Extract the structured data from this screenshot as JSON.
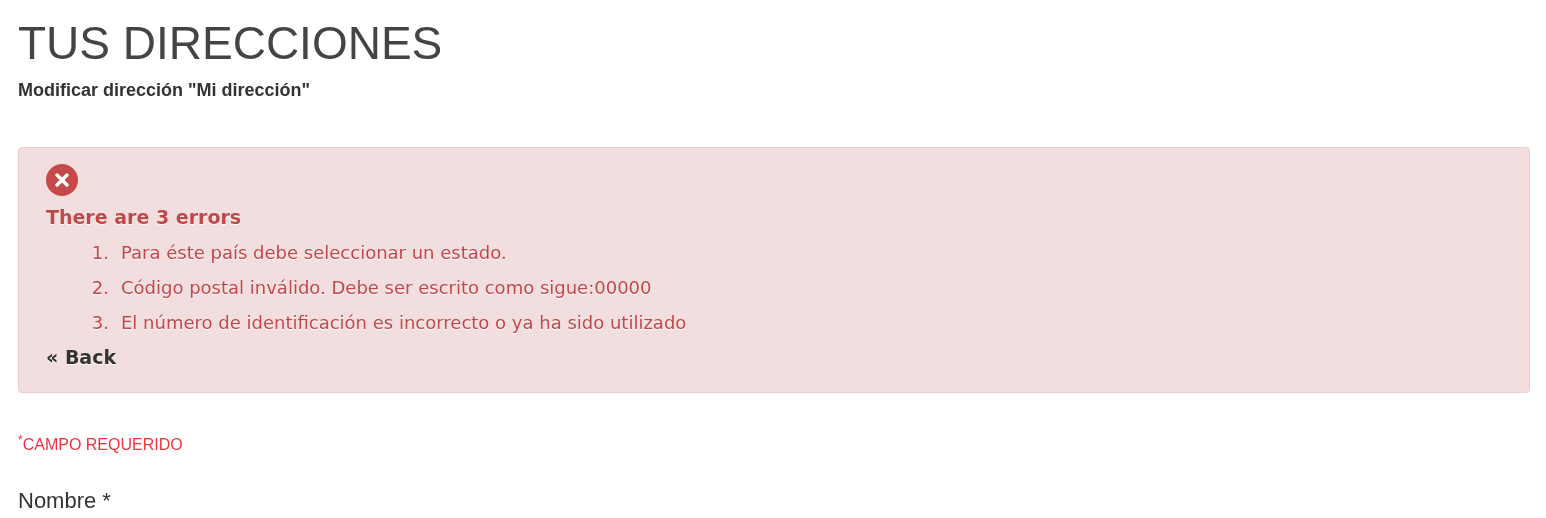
{
  "page_title": "TUS DIRECCIONES",
  "subtitle": "Modificar dirección \"Mi dirección\"",
  "alert": {
    "heading": "There are 3 errors",
    "errors": [
      {
        "number": "1.",
        "text": "Para éste país debe seleccionar un estado."
      },
      {
        "number": "2.",
        "text": "Código postal inválido. Debe ser escrito como sigue:00000"
      },
      {
        "number": "3.",
        "text": "El número de identificación es incorrecto o ya ha sido utilizado"
      }
    ],
    "back_link": "« Back"
  },
  "required_note": "$^{*}$CAMPO REQUERIDO",
  "field_label": "Nombre *"
}
